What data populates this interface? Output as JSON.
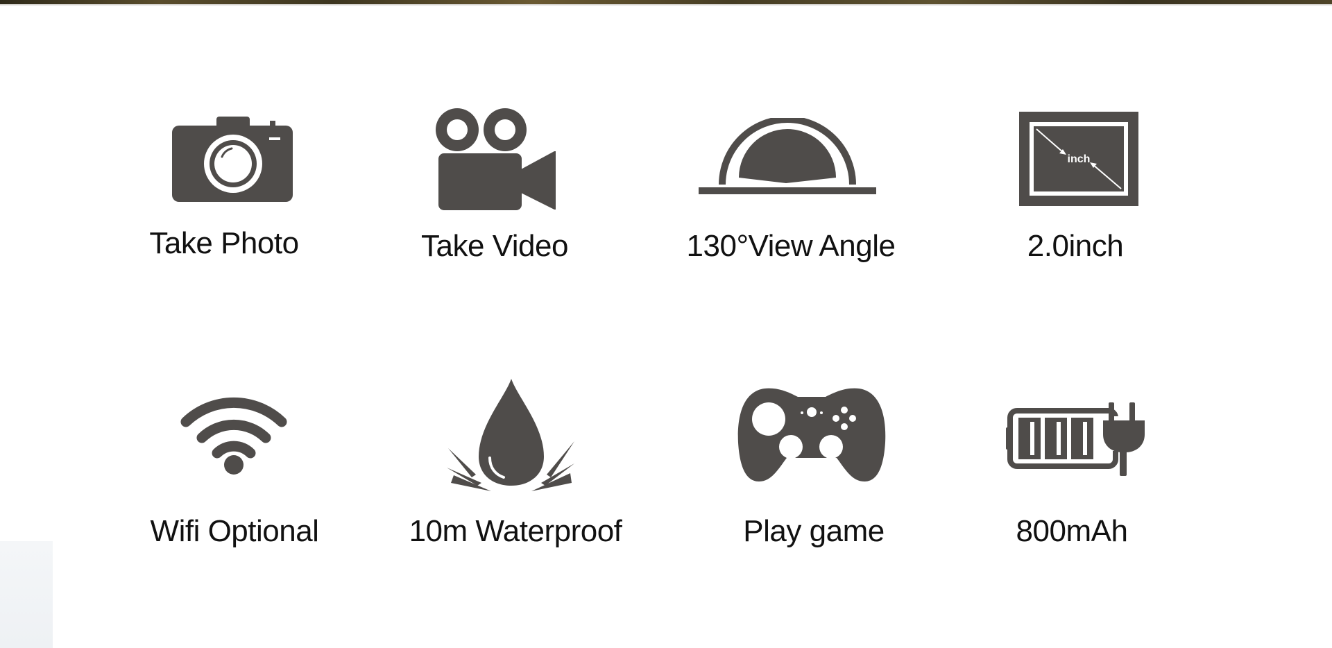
{
  "features": [
    {
      "label": "Take Photo",
      "icon": "camera-icon"
    },
    {
      "label": "Take Video",
      "icon": "video-camera-icon"
    },
    {
      "label": "130°View Angle",
      "icon": "view-angle-icon"
    },
    {
      "label": "2.0inch",
      "icon": "screen-size-icon",
      "icon_text": "inch"
    },
    {
      "label": "Wifi Optional",
      "icon": "wifi-icon"
    },
    {
      "label": "10m Waterproof",
      "icon": "water-drop-icon"
    },
    {
      "label": "Play game",
      "icon": "gamepad-icon"
    },
    {
      "label": "800mAh",
      "icon": "battery-plug-icon"
    }
  ],
  "colors": {
    "icon": "#4f4c4a",
    "text": "#111111",
    "background": "#ffffff"
  }
}
